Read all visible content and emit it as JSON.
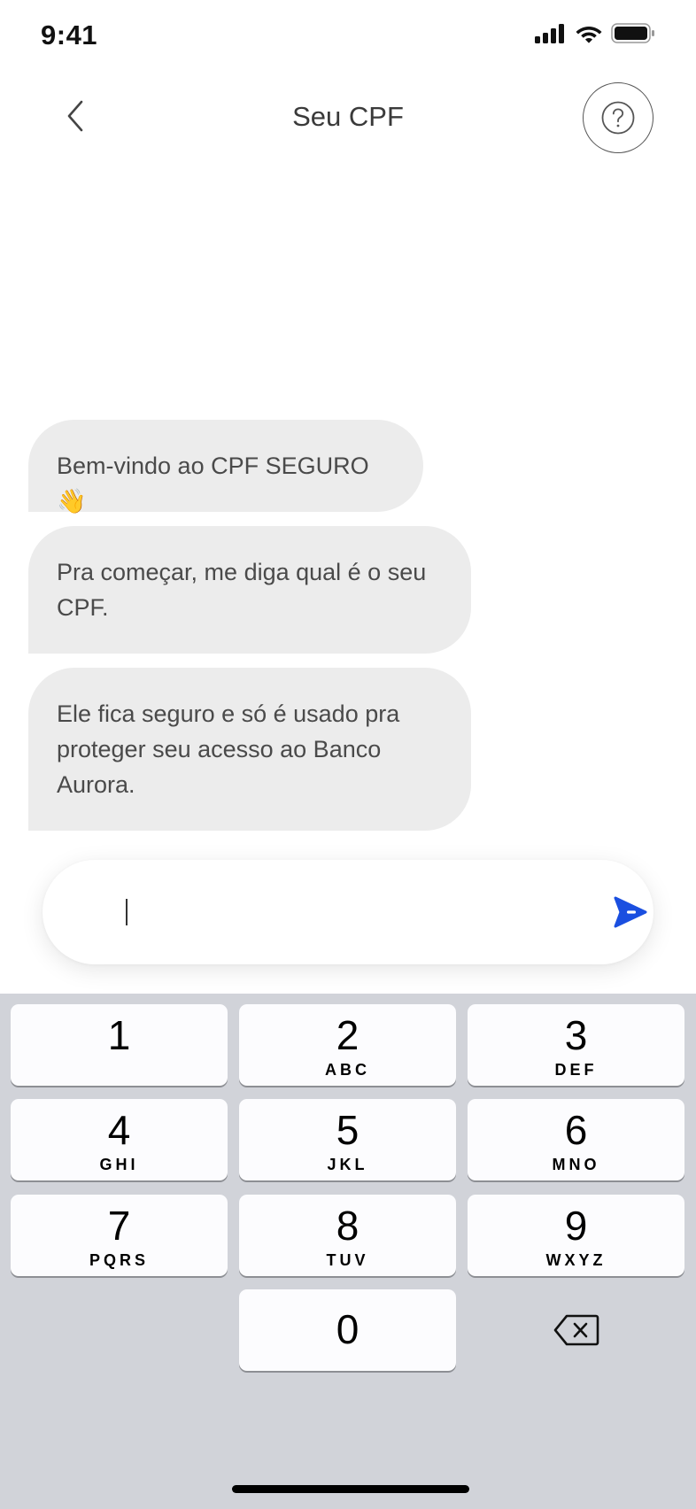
{
  "status_bar": {
    "time": "9:41"
  },
  "header": {
    "title": "Seu CPF"
  },
  "messages": [
    {
      "text": "Bem-vindo ao CPF SEGURO 👋"
    },
    {
      "text": "Pra começar, me diga qual é o seu CPF."
    },
    {
      "text": "Ele fica seguro e só é usado pra proteger seu acesso ao Banco Aurora."
    }
  ],
  "input": {
    "value": "",
    "placeholder": ""
  },
  "colors": {
    "accent": "#1a4fe0",
    "bubble": "#ececec",
    "keypad_bg": "#d1d3d9"
  },
  "keypad": {
    "keys": [
      {
        "digit": "1",
        "letters": ""
      },
      {
        "digit": "2",
        "letters": "ABC"
      },
      {
        "digit": "3",
        "letters": "DEF"
      },
      {
        "digit": "4",
        "letters": "GHI"
      },
      {
        "digit": "5",
        "letters": "JKL"
      },
      {
        "digit": "6",
        "letters": "MNO"
      },
      {
        "digit": "7",
        "letters": "PQRS"
      },
      {
        "digit": "8",
        "letters": "TUV"
      },
      {
        "digit": "9",
        "letters": "WXYZ"
      },
      {
        "digit": "0",
        "letters": ""
      }
    ]
  }
}
